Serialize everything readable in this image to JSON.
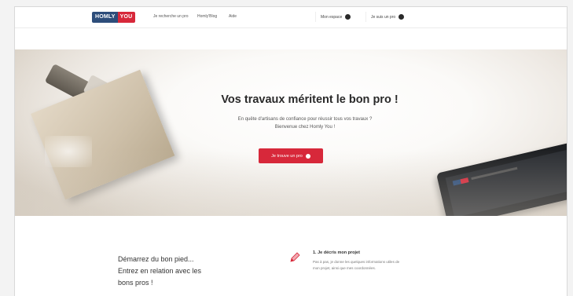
{
  "navbar": {
    "logo_part1": "HOMLY",
    "logo_part2": "YOU",
    "links": [
      "Je recherche un pro",
      "Homly'Blog",
      "Aide"
    ],
    "espace_label": "Mon espace",
    "pro_label": "Je suis un pro"
  },
  "hero": {
    "title": "Vos travaux méritent le bon pro !",
    "subtitle_line1": "En quête d'artisans de confiance pour réussir tous vos travaux ?",
    "subtitle_line2": "Bienvenue chez Homly You !",
    "cta_label": "Je trouve un pro"
  },
  "section": {
    "heading_line1": "Démarrez du bon pied...",
    "heading_line2": "Entrez en relation avec les",
    "heading_line3": "bons pros !",
    "step_title": "1. Je décris mon projet",
    "step_desc_line1": "Pas à pas, je donne les quelques informations utiles de",
    "step_desc_line2": "mon projet, ainsi que mes coordonnées."
  },
  "colors": {
    "brand_blue": "#2d4d7a",
    "brand_red": "#d7283a"
  },
  "icons": {
    "nav_user": "dot-icon",
    "nav_pro": "dot-icon",
    "cta": "dot-icon",
    "step": "pencil-icon"
  }
}
